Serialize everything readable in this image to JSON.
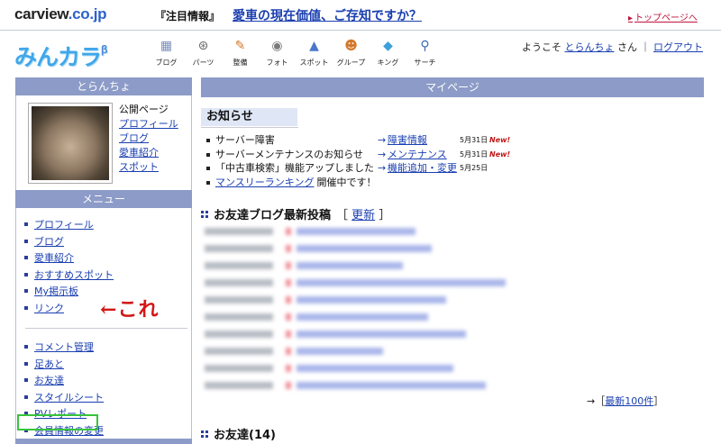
{
  "site": {
    "brand_main": "carview",
    "brand_domain": ".co.jp",
    "notice_tag": "『注目情報』",
    "notice_link": "愛車の現在価値、ご存知ですか？",
    "top_link": "トップページへ"
  },
  "app": {
    "logo": "みんカラ",
    "logo_beta": "β"
  },
  "nav": [
    {
      "label": "ブログ",
      "icon": "blog-icon",
      "glyph": "▦",
      "color": "#7b8fb8"
    },
    {
      "label": "パーツ",
      "icon": "wheel-icon",
      "glyph": "⊛",
      "color": "#6a6a6a"
    },
    {
      "label": "整備",
      "icon": "wrench-icon",
      "glyph": "✎",
      "color": "#d2782a"
    },
    {
      "label": "フォト",
      "icon": "camera-icon",
      "glyph": "◉",
      "color": "#7a7a7a"
    },
    {
      "label": "スポット",
      "icon": "car-icon",
      "glyph": "▲",
      "color": "#4b76c9"
    },
    {
      "label": "グループ",
      "icon": "people-icon",
      "glyph": "☻",
      "color": "#d2782a"
    },
    {
      "label": "キング",
      "icon": "box-icon",
      "glyph": "◆",
      "color": "#3f9fd8"
    },
    {
      "label": "サーチ",
      "icon": "search-icon",
      "glyph": "⚲",
      "color": "#3a6ab5"
    }
  ],
  "user": {
    "welcome": "ようこそ",
    "name": "とらんちょ",
    "san": "さん",
    "separator": "｜",
    "logout": "ログアウト"
  },
  "sidebar": {
    "owner": "とらんちょ",
    "profile_links": [
      "公開ページ",
      "プロフィール",
      "ブログ",
      "愛車紹介",
      "スポット"
    ],
    "menu_title": "メニュー",
    "menu1": [
      "プロフィール",
      "ブログ",
      "愛車紹介",
      "おすすめスポット",
      "My掲示板",
      "リンク"
    ],
    "menu2": [
      "コメント管理",
      "足あと",
      "お友達",
      "スタイルシート",
      "PVレポート",
      "会員情報の変更"
    ],
    "note_arrow": "←",
    "note": "これ"
  },
  "main": {
    "title": "マイページ",
    "news_title": "お知らせ",
    "news": [
      {
        "text": "サーバー障害",
        "arrow": "→",
        "link": "障害情報",
        "date": "5月31日",
        "new": "New!"
      },
      {
        "text": "サーバーメンテナンスのお知らせ",
        "arrow": "→",
        "link": "メンテナンス",
        "date": "5月31日",
        "new": "New!"
      },
      {
        "text": "「中古車検索」機能アップしました",
        "arrow": "→",
        "link": "機能追加・変更",
        "date": "5月25日",
        "new": ""
      },
      {
        "text": "開催中です！",
        "link_first": "マンスリーランキング"
      }
    ],
    "blog_title": "お友達ブログ最新投稿",
    "blog_refresh_open": "［",
    "blog_refresh": "更新",
    "blog_refresh_close": "］",
    "more_prefix": "→［",
    "more_link": "最新100件",
    "more_suffix": "］",
    "friends_title": "お友達(14)"
  }
}
